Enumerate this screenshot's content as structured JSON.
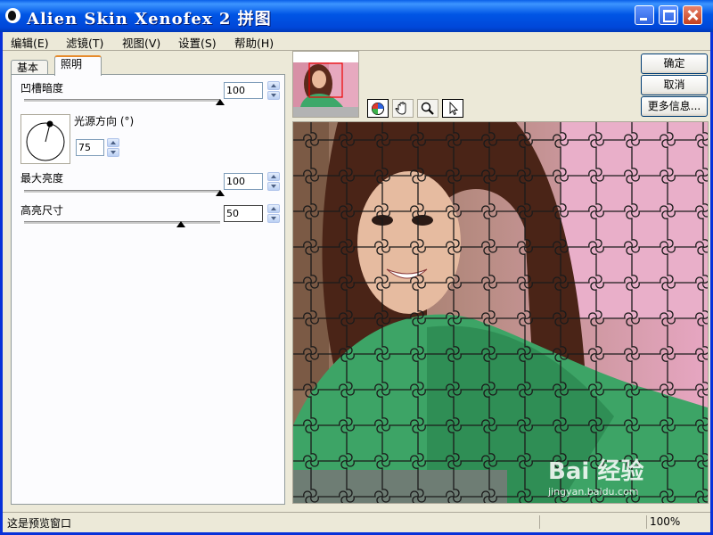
{
  "window": {
    "title": "Alien Skin Xenofex 2 拼图"
  },
  "menu": [
    "编辑(E)",
    "滤镜(T)",
    "视图(V)",
    "设置(S)",
    "帮助(H)"
  ],
  "tabs": {
    "basic": "基本",
    "lighting": "照明"
  },
  "controls": {
    "bevel_label": "凹槽暗度",
    "bevel_value": "100",
    "bevel_level": 1.0,
    "light_dir_label": "光源方向 (°)",
    "light_dir_value": "75",
    "max_brightness_label": "最大亮度",
    "max_brightness_value": "100",
    "max_brightness_level": 1.0,
    "highlight_size_label": "高亮尺寸",
    "highlight_size_value": "50",
    "highlight_size_level": 0.8
  },
  "buttons": {
    "ok": "确定",
    "cancel": "取消",
    "more_info": "更多信息..."
  },
  "tools": [
    "color-picker-icon",
    "hand-icon",
    "zoom-icon",
    "arrow-icon"
  ],
  "status": {
    "message": "这是预览窗口",
    "zoom": "100%"
  },
  "watermark": {
    "brand": "Bai  经验",
    "url": "jingyan.baidu.com"
  },
  "colors": {
    "title_bar": "#0055E5",
    "window_bg": "#ECE9D8",
    "active_tab_accent": "#E68B2C"
  }
}
